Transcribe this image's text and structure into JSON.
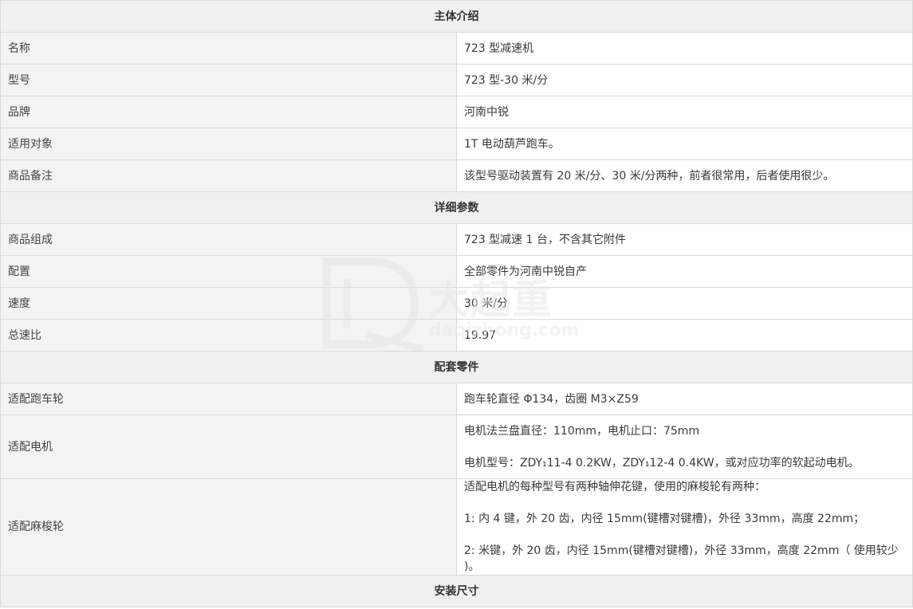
{
  "sections": {
    "intro": "主体介绍",
    "params": "详细参数",
    "parts": "配套零件",
    "install": "安装尺寸"
  },
  "rows": {
    "name": {
      "label": "名称",
      "value": "723 型减速机"
    },
    "model": {
      "label": "型号",
      "value": "723 型-30 米/分"
    },
    "brand": {
      "label": "品牌",
      "value": "河南中锐"
    },
    "target": {
      "label": "适用对象",
      "value": "1T 电动葫芦跑车。"
    },
    "remark": {
      "label": "商品备注",
      "value": "该型号驱动装置有 20 米/分、30 米/分两种，前者很常用，后者使用很少。"
    },
    "composition": {
      "label": "商品组成",
      "value": "723 型减速 1 台，不含其它附件"
    },
    "config": {
      "label": "配置",
      "value": "全部零件为河南中锐自产"
    },
    "speed": {
      "label": "速度",
      "value": "30  米/分"
    },
    "ratio": {
      "label": "总速比",
      "value": "19.97"
    },
    "wheel": {
      "label": "适配跑车轮",
      "value": "跑车轮直径 Φ134，齿圈 M3×Z59"
    },
    "motor": {
      "label": "适配电机",
      "lines": [
        "电机法兰盘直径：110mm，电机止口：75mm",
        "电机型号：ZDY₁11-4    0.2KW，ZDY₁12-4    0.4KW，或对应功率的软起动电机。"
      ]
    },
    "spline": {
      "label": "适配麻梭轮",
      "lines": [
        "适配电机的每种型号有两种轴伸花键，使用的麻梭轮有两种：",
        "1:  内 4 键，外 20 齿，内径 15mm(键槽对键槽)，外径 33mm，高度 22mm；",
        "2:  米键，外 20 齿，内径 15mm(键槽对键槽)，外径 33mm，高度 22mm（ 使用较少 )。"
      ]
    }
  },
  "watermark": {
    "cn": "大起重",
    "en": "daqizhong.com"
  }
}
